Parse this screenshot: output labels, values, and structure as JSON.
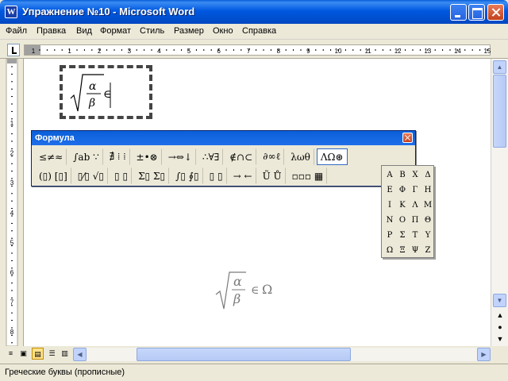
{
  "window": {
    "title": "Упражнение №10 - Microsoft Word",
    "app_icon": "W"
  },
  "menu": [
    "Файл",
    "Правка",
    "Вид",
    "Формат",
    "Стиль",
    "Размер",
    "Окно",
    "Справка"
  ],
  "ruler": {
    "h_numbers": [
      "1",
      "1",
      "2",
      "3",
      "4",
      "5",
      "6",
      "7",
      "8",
      "9",
      "10",
      "11",
      "12",
      "13",
      "14",
      "15"
    ],
    "v_numbers": [
      "1",
      "2",
      "3",
      "4",
      "5",
      "6",
      "7",
      "8",
      "9",
      "10"
    ]
  },
  "formula_toolbar": {
    "title": "Формула",
    "row1": [
      "≤≠≈",
      "∫ab ∵",
      "∄ ⁞ ⁞",
      "±•⊗",
      "→⇔↓",
      "∴∀∃",
      "∉∩⊂",
      "∂∞ℓ",
      "λωθ",
      "ΛΩ⊛"
    ],
    "row2": [
      "(▯) [▯]",
      "▯⁄▯ √▯",
      "▯ ▯",
      "Σ▯ Σ▯",
      "∫▯ ∮▯",
      "▯ ▯",
      "→ ←",
      "Ũ Ů",
      "▫▫▫ ▦"
    ]
  },
  "greek_panel": {
    "letters": [
      "Α",
      "Β",
      "Χ",
      "Δ",
      "Ε",
      "Φ",
      "Γ",
      "Η",
      "Ι",
      "Κ",
      "Λ",
      "Μ",
      "Ν",
      "Ο",
      "Π",
      "Θ",
      "Ρ",
      "Σ",
      "Τ",
      "Υ",
      "Ω",
      "Ξ",
      "Ψ",
      "Ζ"
    ]
  },
  "equation": {
    "numerator": "α",
    "denominator": "β",
    "relation": "∈",
    "rhs": "Ω"
  },
  "status": {
    "text": "Греческие буквы (прописные)"
  },
  "icons": {
    "titlebar": [
      "minimize-icon",
      "maximize-icon",
      "close-icon"
    ],
    "colors": {
      "title_blue": "#0058E0",
      "close_red": "#C2401C",
      "face": "#ECE9D8"
    }
  }
}
